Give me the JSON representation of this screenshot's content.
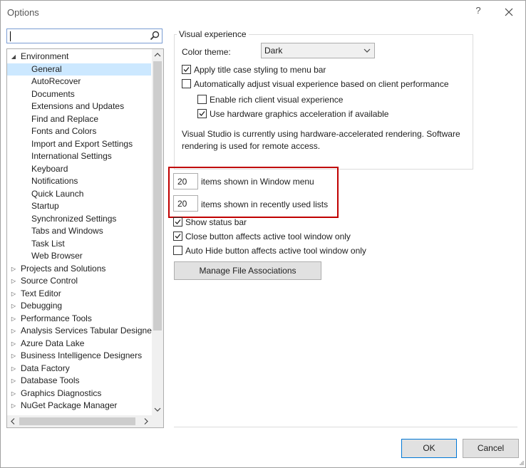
{
  "window": {
    "title": "Options",
    "help": "?"
  },
  "search": {
    "value": "",
    "placeholder": ""
  },
  "tree": {
    "items": [
      {
        "label": "Environment",
        "level": 0,
        "expanded": true
      },
      {
        "label": "General",
        "level": 1,
        "selected": true
      },
      {
        "label": "AutoRecover",
        "level": 1
      },
      {
        "label": "Documents",
        "level": 1
      },
      {
        "label": "Extensions and Updates",
        "level": 1
      },
      {
        "label": "Find and Replace",
        "level": 1
      },
      {
        "label": "Fonts and Colors",
        "level": 1
      },
      {
        "label": "Import and Export Settings",
        "level": 1
      },
      {
        "label": "International Settings",
        "level": 1
      },
      {
        "label": "Keyboard",
        "level": 1
      },
      {
        "label": "Notifications",
        "level": 1
      },
      {
        "label": "Quick Launch",
        "level": 1
      },
      {
        "label": "Startup",
        "level": 1
      },
      {
        "label": "Synchronized Settings",
        "level": 1
      },
      {
        "label": "Tabs and Windows",
        "level": 1
      },
      {
        "label": "Task List",
        "level": 1
      },
      {
        "label": "Web Browser",
        "level": 1
      },
      {
        "label": "Projects and Solutions",
        "level": 0
      },
      {
        "label": "Source Control",
        "level": 0
      },
      {
        "label": "Text Editor",
        "level": 0
      },
      {
        "label": "Debugging",
        "level": 0
      },
      {
        "label": "Performance Tools",
        "level": 0
      },
      {
        "label": "Analysis Services Tabular Designer",
        "level": 0
      },
      {
        "label": "Azure Data Lake",
        "level": 0
      },
      {
        "label": "Business Intelligence Designers",
        "level": 0
      },
      {
        "label": "Data Factory",
        "level": 0
      },
      {
        "label": "Database Tools",
        "level": 0
      },
      {
        "label": "Graphics Diagnostics",
        "level": 0
      },
      {
        "label": "NuGet Package Manager",
        "level": 0
      }
    ]
  },
  "visual": {
    "group_label": "Visual experience",
    "color_theme_label": "Color theme:",
    "color_theme_value": "Dark",
    "title_case_label": "Apply title case styling to menu bar",
    "title_case_checked": true,
    "auto_adjust_label": "Automatically adjust visual experience based on client performance",
    "auto_adjust_checked": false,
    "rich_client_label": "Enable rich client visual experience",
    "rich_client_checked": false,
    "hw_accel_label": "Use hardware graphics acceleration if available",
    "hw_accel_checked": true,
    "info_text": "Visual Studio is currently using hardware-accelerated rendering. Software rendering is used for remote access."
  },
  "window_menu": {
    "count": "20",
    "label": "items shown in Window menu"
  },
  "recent_lists": {
    "count": "20",
    "label": "items shown in recently used lists"
  },
  "options": {
    "status_bar_label": "Show status bar",
    "status_bar_checked": true,
    "close_button_label": "Close button affects active tool window only",
    "close_button_checked": true,
    "auto_hide_label": "Auto Hide button affects active tool window only",
    "auto_hide_checked": false
  },
  "buttons": {
    "file_assoc": "Manage File Associations",
    "ok": "OK",
    "cancel": "Cancel"
  },
  "colors": {
    "selection": "#cce8ff",
    "highlight_border": "#c00000",
    "primary_border": "#0078d7"
  }
}
